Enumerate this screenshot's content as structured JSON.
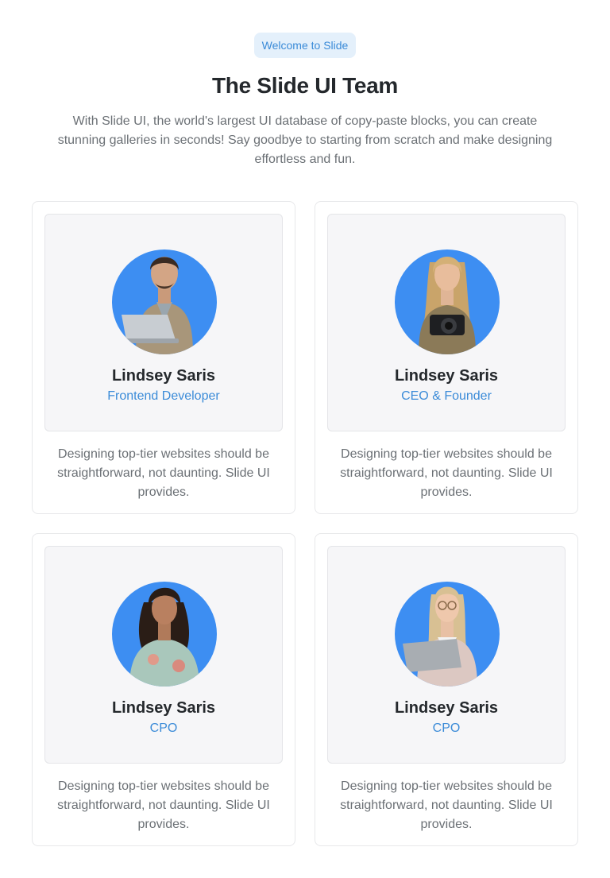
{
  "header": {
    "badge": "Welcome to Slide",
    "title": "The Slide UI Team",
    "subtitle": "With Slide UI, the world's largest UI database of copy-paste blocks, you can create stunning galleries in seconds! Say goodbye to starting from scratch and make designing effortless and fun."
  },
  "team": [
    {
      "name": "Lindsey Saris",
      "role": "Frontend Developer",
      "description": "Designing top-tier websites should be straightforward, not daunting. Slide UI provides."
    },
    {
      "name": "Lindsey Saris",
      "role": "CEO & Founder",
      "description": "Designing top-tier websites should be straightforward, not daunting. Slide UI provides."
    },
    {
      "name": "Lindsey Saris",
      "role": "CPO",
      "description": "Designing top-tier websites should be straightforward, not daunting. Slide UI provides."
    },
    {
      "name": "Lindsey Saris",
      "role": "CPO",
      "description": "Designing top-tier websites should be straightforward, not daunting. Slide UI provides."
    }
  ],
  "colors": {
    "accent": "#3b8bd8",
    "avatar_background": "#3d8ef2",
    "badge_background": "#e4f0fb"
  }
}
